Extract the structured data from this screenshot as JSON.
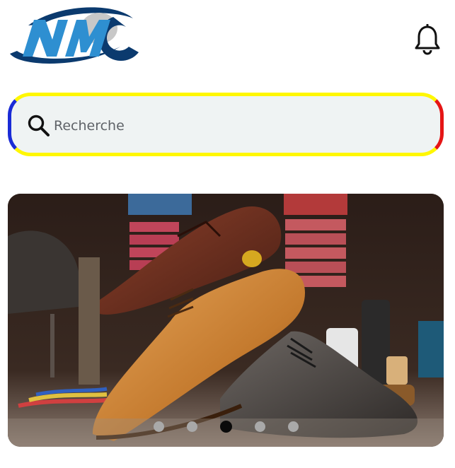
{
  "header": {
    "logo": {
      "text": "NMC",
      "colors": {
        "blue": "#2e8fd1",
        "navy": "#0b3a6e",
        "gray": "#c8c8c8"
      }
    },
    "notification_icon": "bell-icon"
  },
  "search": {
    "placeholder": "Recherche",
    "icon": "search-icon",
    "border_colors": {
      "top_bottom": "#fff700",
      "left": "#1a2bd6",
      "right": "#e51515"
    }
  },
  "carousel": {
    "image": "leather-dress-shoes-display",
    "slides": 5,
    "active_index": 2
  }
}
